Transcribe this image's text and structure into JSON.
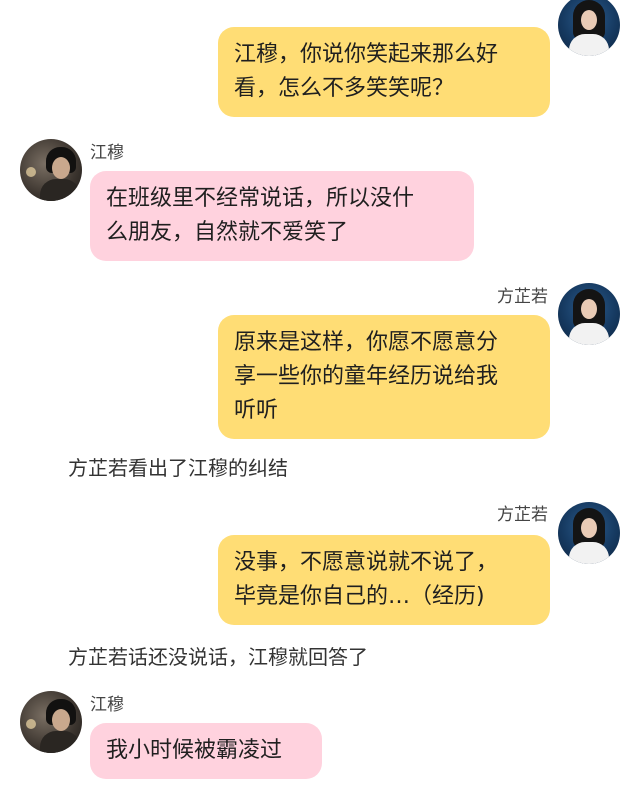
{
  "participants": {
    "girl": {
      "name": "方芷若"
    },
    "boy": {
      "name": "江穆"
    }
  },
  "messages": [
    {
      "from": "girl",
      "lines": [
        "江穆，你说你笑起来那么好",
        "看，怎么不多笑笑呢？"
      ]
    },
    {
      "from": "boy",
      "lines": [
        "在班级里不经常说话，所以没什",
        "么朋友，自然就不爱笑了"
      ]
    },
    {
      "from": "girl",
      "lines": [
        "原来是这样，你愿不愿意分",
        "享一些你的童年经历说给我",
        "听听"
      ]
    },
    {
      "from": "girl",
      "lines": [
        "没事，不愿意说就不说了，",
        "毕竟是你自己的…（经历)"
      ]
    },
    {
      "from": "boy",
      "lines": [
        "我小时候被霸凌过"
      ]
    }
  ],
  "narrations": [
    "方芷若看出了江穆的纠结",
    "方芷若话还没说话，江穆就回答了"
  ],
  "colors": {
    "girl_bubble": "#ffdd75",
    "boy_bubble": "#ffd2de",
    "background": "#ffffff"
  },
  "icons": {
    "girl_avatar": "girl-avatar-photo",
    "boy_avatar": "boy-avatar-photo"
  }
}
